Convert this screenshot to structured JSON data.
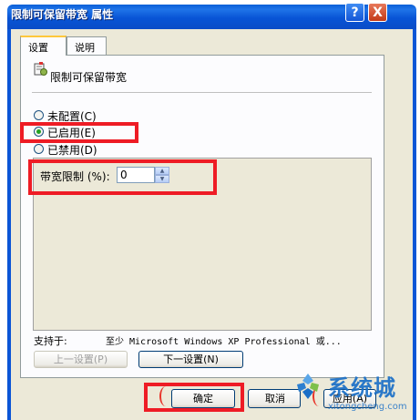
{
  "window": {
    "title": "限制可保留带宽 属性",
    "help_glyph": "?",
    "close_glyph": "X"
  },
  "tabs": [
    {
      "label": "设置",
      "active": true
    },
    {
      "label": "说明",
      "active": false
    }
  ],
  "policy": {
    "name": "限制可保留带宽",
    "icon": "policy-settings-icon"
  },
  "radios": [
    {
      "label": "未配置(C)",
      "checked": false
    },
    {
      "label": "已启用(E)",
      "checked": true
    },
    {
      "label": "已禁用(D)",
      "checked": false
    }
  ],
  "options": {
    "bandwidth_label": "带宽限制 (%):",
    "bandwidth_value": "0"
  },
  "supported": {
    "label": "支持于:",
    "value": "至少 Microsoft Windows XP Professional 或..."
  },
  "nav_buttons": {
    "prev": "上一设置(P)",
    "next": "下一设置(N)"
  },
  "dialog_buttons": {
    "ok": "确定",
    "cancel": "取消",
    "apply": "应用(A)"
  },
  "watermark": {
    "brand": "系统城",
    "url": "xitongcheng.com"
  },
  "colors": {
    "highlight": "#ee1c25",
    "titlebar": "#0a55d6",
    "watermark": "#1a6fc7"
  }
}
